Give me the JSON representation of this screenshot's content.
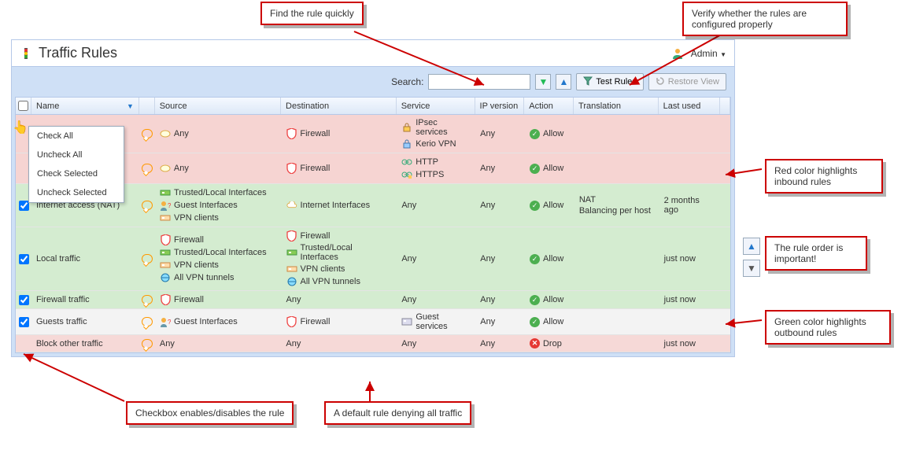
{
  "header": {
    "title": "Traffic Rules",
    "user_label": "Admin"
  },
  "toolbar": {
    "search_label": "Search:",
    "search_placeholder": "",
    "test_rules_label": "Test Rules",
    "restore_view_label": "Restore View"
  },
  "columns": {
    "name": "Name",
    "source": "Source",
    "destination": "Destination",
    "service": "Service",
    "ip_version": "IP version",
    "action": "Action",
    "translation": "Translation",
    "last_used": "Last used"
  },
  "menu": {
    "check_all": "Check All",
    "uncheck_all": "Uncheck All",
    "check_selected": "Check Selected",
    "uncheck_selected": "Uncheck Selected"
  },
  "rows": [
    {
      "id": "r1",
      "class": "red",
      "source": [
        {
          "icon": "any",
          "text": "Any"
        }
      ],
      "destination": [
        {
          "icon": "firewall",
          "text": "Firewall"
        }
      ],
      "service": [
        {
          "icon": "ipsec",
          "text": "IPsec services"
        },
        {
          "icon": "kerio",
          "text": "Kerio VPN"
        }
      ],
      "ip_version": "Any",
      "action": {
        "type": "allow",
        "text": "Allow"
      },
      "translation": "",
      "last_used": ""
    },
    {
      "id": "r2",
      "class": "red",
      "source": [
        {
          "icon": "any",
          "text": "Any"
        }
      ],
      "destination": [
        {
          "icon": "firewall",
          "text": "Firewall"
        }
      ],
      "service": [
        {
          "icon": "http",
          "text": "HTTP"
        },
        {
          "icon": "https",
          "text": "HTTPS"
        }
      ],
      "ip_version": "Any",
      "action": {
        "type": "allow",
        "text": "Allow"
      },
      "translation": "",
      "last_used": ""
    },
    {
      "id": "r3",
      "class": "green",
      "checked": true,
      "name": "Internet access (NAT)",
      "source": [
        {
          "icon": "trusted",
          "text": "Trusted/Local Interfaces"
        },
        {
          "icon": "guest",
          "text": "Guest Interfaces"
        },
        {
          "icon": "vpn",
          "text": "VPN clients"
        }
      ],
      "destination": [
        {
          "icon": "internet",
          "text": "Internet Interfaces"
        }
      ],
      "service_text": "Any",
      "ip_version": "Any",
      "action": {
        "type": "allow",
        "text": "Allow"
      },
      "translation": "NAT\nBalancing per host",
      "translation_l1": "NAT",
      "translation_l2": "Balancing per host",
      "last_used": "2 months ago"
    },
    {
      "id": "r4",
      "class": "green",
      "checked": true,
      "name": "Local traffic",
      "source": [
        {
          "icon": "firewall",
          "text": "Firewall"
        },
        {
          "icon": "trusted",
          "text": "Trusted/Local Interfaces"
        },
        {
          "icon": "vpn",
          "text": "VPN clients"
        },
        {
          "icon": "vpntun",
          "text": "All VPN tunnels"
        }
      ],
      "destination": [
        {
          "icon": "firewall",
          "text": "Firewall"
        },
        {
          "icon": "trusted",
          "text": "Trusted/Local Interfaces"
        },
        {
          "icon": "vpn",
          "text": "VPN clients"
        },
        {
          "icon": "vpntun",
          "text": "All VPN tunnels"
        }
      ],
      "service_text": "Any",
      "ip_version": "Any",
      "action": {
        "type": "allow",
        "text": "Allow"
      },
      "translation": "",
      "last_used": "just now"
    },
    {
      "id": "r5",
      "class": "green",
      "checked": true,
      "name": "Firewall traffic",
      "source": [
        {
          "icon": "firewall",
          "text": "Firewall"
        }
      ],
      "service_text_src": "",
      "destination_text": "Any",
      "service_text": "Any",
      "ip_version": "Any",
      "action": {
        "type": "allow",
        "text": "Allow"
      },
      "translation": "",
      "last_used": "just now"
    },
    {
      "id": "r6",
      "class": "grey",
      "checked": true,
      "name": "Guests traffic",
      "source": [
        {
          "icon": "guest",
          "text": "Guest Interfaces"
        }
      ],
      "destination": [
        {
          "icon": "firewall",
          "text": "Firewall"
        }
      ],
      "service": [
        {
          "icon": "guestsvc",
          "text": "Guest services"
        }
      ],
      "ip_version": "Any",
      "action": {
        "type": "allow",
        "text": "Allow"
      },
      "translation": "",
      "last_used": ""
    },
    {
      "id": "r7",
      "class": "pale-red",
      "name": "Block other traffic",
      "source_text": "Any",
      "destination_text": "Any",
      "service_text": "Any",
      "ip_version": "Any",
      "action": {
        "type": "drop",
        "text": "Drop"
      },
      "translation": "",
      "last_used": "just now"
    }
  ],
  "callouts": {
    "find_rule": "Find the rule quickly",
    "verify_rules": "Verify whether the rules are configured properly",
    "red_highlight": "Red color highlights inbound rules",
    "rule_order": "The rule order is important!",
    "green_highlight": "Green color highlights outbound rules",
    "checkbox_enable": "Checkbox enables/disables the rule",
    "default_rule": "A default rule denying all traffic"
  }
}
